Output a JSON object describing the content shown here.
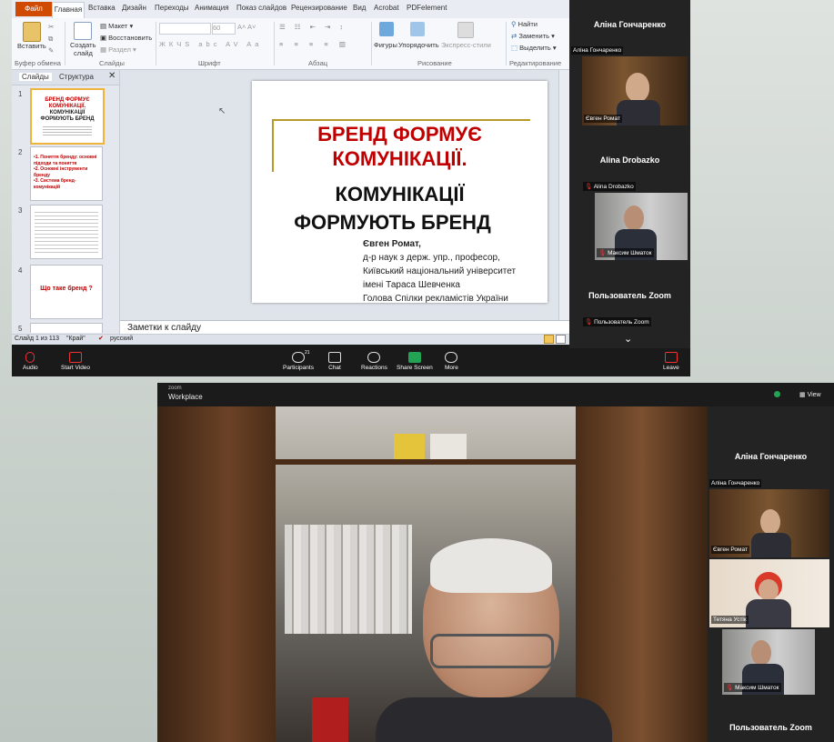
{
  "ppt": {
    "tabs": [
      "Файл",
      "Главная",
      "Вставка",
      "Дизайн",
      "Переходы",
      "Анимация",
      "Показ слайдов",
      "Рецензирование",
      "Вид",
      "Acrobat",
      "PDFelement"
    ],
    "clipboard": {
      "paste": "Вставить",
      "label": "Буфер обмена"
    },
    "slides_group": {
      "create": "Создать",
      "create2": "слайд",
      "layout": "Макет",
      "reset": "Восстановить",
      "section": "Раздел",
      "label": "Слайды"
    },
    "font_group": {
      "size": "60",
      "label": "Шрифт"
    },
    "para_group": {
      "label": "Абзац"
    },
    "drawing_group": {
      "shapes": "Фигуры",
      "arrange": "Упорядочить",
      "express": "Экспресс-стили",
      "label": "Рисование"
    },
    "editing_group": {
      "find": "Найти",
      "replace": "Заменить",
      "select": "Выделить",
      "label": "Редактирование"
    },
    "panel_tabs": [
      "Слайды",
      "Структура"
    ],
    "thumbnails": [
      {
        "num": "1",
        "lines": [
          "БРЕНД ФОРМУЄ",
          "КОМУНІКАЦІЇ.",
          "КОМУНІКАЦІЇ",
          "ФОРМУЮТЬ БРЕНД"
        ]
      },
      {
        "num": "2",
        "lines": [
          "•1. Поняття бренду: основні",
          "підходи та поняття",
          "•2. Основні інструменти",
          "бренду",
          "•3. Система бренд-",
          "комунікацій"
        ]
      },
      {
        "num": "3",
        "lines": []
      },
      {
        "num": "4",
        "lines": [
          "Що таке бренд ?"
        ]
      },
      {
        "num": "5",
        "lines": []
      }
    ],
    "slide": {
      "title_red_1": "БРЕНД ФОРМУЄ",
      "title_red_2": "КОМУНІКАЦІЇ.",
      "title_black_1": "КОМУНІКАЦІЇ",
      "title_black_2": "ФОРМУЮТЬ БРЕНД",
      "author": "Євген Ромат,",
      "info": [
        "д-р наук з держ. упр., професор,",
        "Київський національний університет",
        "імені Тараса Шевченка",
        "Голова Спілки рекламістів України"
      ]
    },
    "notes_placeholder": "Заметки к слайду",
    "status": {
      "slide": "Слайд 1 из 113",
      "theme": "\"Край\"",
      "lang": "русский"
    },
    "colors": {
      "accent": "#d04a02",
      "slide_red": "#c00000",
      "gold": "#b89a2a"
    }
  },
  "zoom_top": {
    "participants": [
      {
        "name": "Аліна Гончаренко",
        "small": "Аліна Гончаренко"
      },
      {
        "small": "Євген Ромат"
      },
      {
        "name": "Alina Drobazko",
        "small": "Alina Drobazko"
      },
      {
        "small": "Максим Шматок"
      },
      {
        "name": "Пользователь Zoom",
        "small": "Пользователь Zoom"
      }
    ],
    "toolbar": {
      "audio": "Audio",
      "video": "Start Video",
      "participants": "Participants",
      "participants_count": "21",
      "chat": "Chat",
      "reactions": "Reactions",
      "share": "Share Screen",
      "more": "More",
      "leave": "Leave"
    }
  },
  "zoom_bottom": {
    "brand_top": "zoom",
    "brand": "Workplace",
    "view": "View",
    "participants": [
      {
        "name": "Аліна Гончаренко",
        "small": "Аліна Гончаренко"
      },
      {
        "small": "Євген Ромат"
      },
      {
        "small": "Тетяна Устік"
      },
      {
        "small": "Максим Шматок"
      },
      {
        "name": "Пользователь Zoom"
      }
    ]
  }
}
